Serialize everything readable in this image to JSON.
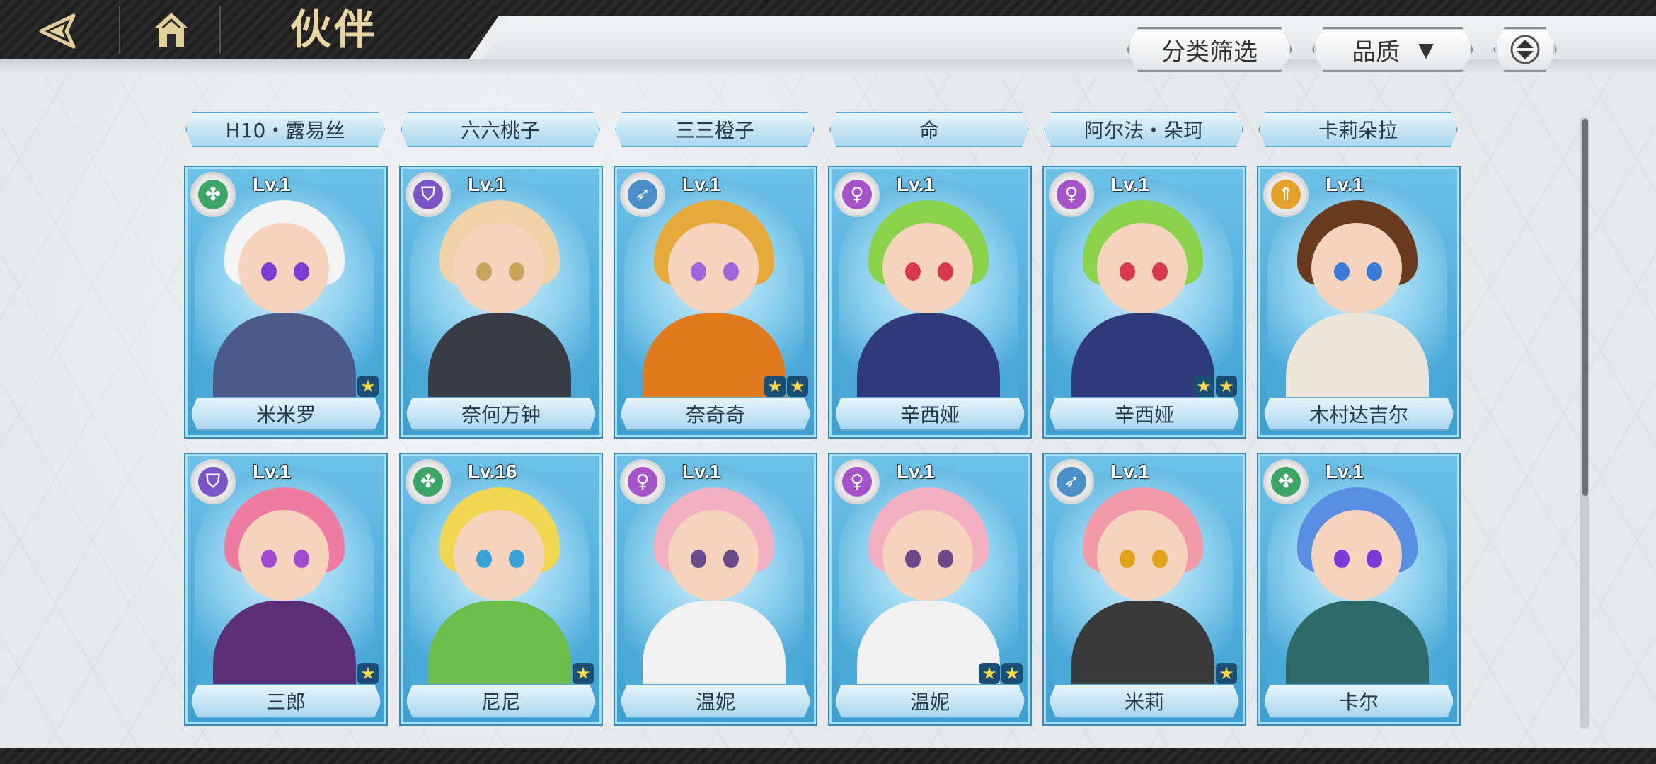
{
  "header": {
    "title": "伙伴",
    "back_icon": "back-arrow-icon",
    "home_icon": "home-icon",
    "filter_label": "分类筛选",
    "sort_label": "品质",
    "sort_icon": "triangle-down-icon",
    "order_icon": "sort-order-icon"
  },
  "tabs": [
    {
      "label": "H10・露易丝"
    },
    {
      "label": "六六桃子"
    },
    {
      "label": "三三橙子"
    },
    {
      "label": "命"
    },
    {
      "label": "阿尔法・朵珂"
    },
    {
      "label": "卡莉朵拉"
    }
  ],
  "cards": [
    {
      "name": "米米罗",
      "level": "Lv.1",
      "stars": 1,
      "role": "heal",
      "role_color": "#3aa564",
      "hair": "#f3f3f3",
      "body": "#4b5a8a",
      "eye": "#7a3dd1"
    },
    {
      "name": "奈何万钟",
      "level": "Lv.1",
      "stars": 0,
      "role": "shield",
      "role_color": "#7a55c8",
      "hair": "#f0d2a8",
      "body": "#3a3a44",
      "eye": "#caa25a"
    },
    {
      "name": "奈奇奇",
      "level": "Lv.1",
      "stars": 2,
      "role": "bow",
      "role_color": "#4a8fc8",
      "hair": "#e6a93b",
      "body": "#e07a1e",
      "eye": "#a065d8"
    },
    {
      "name": "辛西娅",
      "level": "Lv.1",
      "stars": 0,
      "role": "magic",
      "role_color": "#a652c9",
      "hair": "#8ad24a",
      "body": "#2e3a7a",
      "eye": "#d83a4a"
    },
    {
      "name": "辛西娅",
      "level": "Lv.1",
      "stars": 2,
      "role": "magic",
      "role_color": "#a652c9",
      "hair": "#8ad24a",
      "body": "#2e3a7a",
      "eye": "#d83a4a"
    },
    {
      "name": "木村达吉尔",
      "level": "Lv.1",
      "stars": 0,
      "role": "attack",
      "role_color": "#e5a12a",
      "hair": "#6a3a1e",
      "body": "#ebe6d8",
      "eye": "#3a7ad8"
    },
    {
      "name": "三郎",
      "level": "Lv.1",
      "stars": 1,
      "role": "shield",
      "role_color": "#7a55c8",
      "hair": "#ef7aa2",
      "body": "#5b2f78",
      "eye": "#a04ad0"
    },
    {
      "name": "尼尼",
      "level": "Lv.16",
      "stars": 1,
      "role": "heal",
      "role_color": "#3aa564",
      "hair": "#f2d652",
      "body": "#6cbd4a",
      "eye": "#3aa2d8"
    },
    {
      "name": "温妮",
      "level": "Lv.1",
      "stars": 0,
      "role": "magic",
      "role_color": "#a652c9",
      "hair": "#f3b0c4",
      "body": "#f1f1f1",
      "eye": "#6a4a8a"
    },
    {
      "name": "温妮",
      "level": "Lv.1",
      "stars": 2,
      "role": "magic",
      "role_color": "#a652c9",
      "hair": "#f3b0c4",
      "body": "#f1f1f1",
      "eye": "#6a4a8a"
    },
    {
      "name": "米莉",
      "level": "Lv.1",
      "stars": 1,
      "role": "bow",
      "role_color": "#4a8fc8",
      "hair": "#f29aa8",
      "body": "#3a3a3a",
      "eye": "#e2a21a"
    },
    {
      "name": "卡尔",
      "level": "Lv.1",
      "stars": 0,
      "role": "heal",
      "role_color": "#3aa564",
      "hair": "#5a8ee0",
      "body": "#2e6a6a",
      "eye": "#7a3ad8"
    }
  ],
  "scroll": {
    "position": 0.0,
    "visible_fraction": 0.62
  }
}
